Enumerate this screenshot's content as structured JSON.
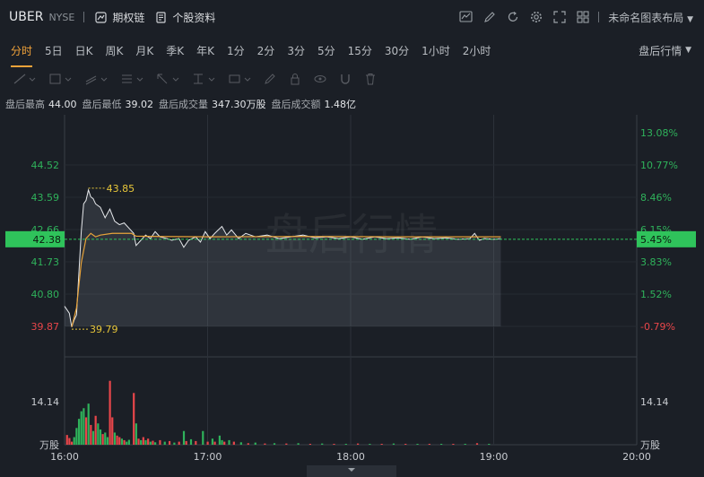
{
  "header": {
    "symbol": "UBER",
    "exchange": "NYSE",
    "options_chain": "期权链",
    "company_profile": "个股资料",
    "layout_name": "未命名图表布局"
  },
  "periods": [
    "分时",
    "5日",
    "日K",
    "周K",
    "月K",
    "季K",
    "年K",
    "1分",
    "2分",
    "3分",
    "5分",
    "15分",
    "30分",
    "1小时",
    "2小时"
  ],
  "active_period": "分时",
  "after_hours_menu": "盘后行情",
  "stats": {
    "high_label": "盘后最高",
    "high": "44.00",
    "low_label": "盘后最低",
    "low": "39.02",
    "vol_label": "盘后成交量",
    "vol": "347.30万股",
    "amt_label": "盘后成交额",
    "amt": "1.48亿"
  },
  "watermark": "盘后行情",
  "colors": {
    "up": "#2fb25b",
    "down": "#e8464a",
    "avg": "#e8a33a",
    "price": "#e6e8eb",
    "marker": "#e8c73a",
    "current_bg": "#2fc35b"
  },
  "chart_data": {
    "type": "line",
    "title": "",
    "price_axis_left": [
      "44.52",
      "43.59",
      "42.66",
      "41.73",
      "40.80",
      "39.87"
    ],
    "pct_axis_right": [
      "13.08%",
      "10.77%",
      "8.46%",
      "6.15%",
      "3.83%",
      "1.52%",
      "-0.79%"
    ],
    "ylim": [
      39.87,
      44.52
    ],
    "current_price": "42.38",
    "current_pct": "5.45%",
    "high_marker": "43.85",
    "low_marker": "39.79",
    "x_ticks": [
      "16:00",
      "17:00",
      "18:00",
      "19:00",
      "20:00"
    ],
    "volume_axis": [
      "14.14"
    ],
    "volume_unit_left": "万股",
    "volume_unit_right": "万股",
    "price_series": [
      {
        "t": 0,
        "v": 40.45
      },
      {
        "t": 2,
        "v": 40.25
      },
      {
        "t": 3,
        "v": 39.85
      },
      {
        "t": 4,
        "v": 40.05
      },
      {
        "t": 5,
        "v": 40.2
      },
      {
        "t": 6,
        "v": 41.4
      },
      {
        "t": 7,
        "v": 42.6
      },
      {
        "t": 8,
        "v": 43.4
      },
      {
        "t": 9,
        "v": 43.5
      },
      {
        "t": 10,
        "v": 43.8
      },
      {
        "t": 11,
        "v": 43.6
      },
      {
        "t": 12,
        "v": 43.55
      },
      {
        "t": 13,
        "v": 43.4
      },
      {
        "t": 15,
        "v": 43.3
      },
      {
        "t": 17,
        "v": 43.0
      },
      {
        "t": 19,
        "v": 43.25
      },
      {
        "t": 21,
        "v": 42.9
      },
      {
        "t": 23,
        "v": 42.8
      },
      {
        "t": 25,
        "v": 42.85
      },
      {
        "t": 27,
        "v": 42.7
      },
      {
        "t": 29,
        "v": 42.55
      },
      {
        "t": 30,
        "v": 42.2
      },
      {
        "t": 32,
        "v": 42.35
      },
      {
        "t": 34,
        "v": 42.5
      },
      {
        "t": 36,
        "v": 42.4
      },
      {
        "t": 38,
        "v": 42.6
      },
      {
        "t": 40,
        "v": 42.45
      },
      {
        "t": 43,
        "v": 42.4
      },
      {
        "t": 45,
        "v": 42.35
      },
      {
        "t": 48,
        "v": 42.4
      },
      {
        "t": 50,
        "v": 42.15
      },
      {
        "t": 52,
        "v": 42.35
      },
      {
        "t": 55,
        "v": 42.45
      },
      {
        "t": 57,
        "v": 42.3
      },
      {
        "t": 59,
        "v": 42.6
      },
      {
        "t": 61,
        "v": 42.4
      },
      {
        "t": 63,
        "v": 42.55
      },
      {
        "t": 66,
        "v": 42.75
      },
      {
        "t": 68,
        "v": 42.5
      },
      {
        "t": 70,
        "v": 42.65
      },
      {
        "t": 73,
        "v": 42.4
      },
      {
        "t": 76,
        "v": 42.55
      },
      {
        "t": 80,
        "v": 42.45
      },
      {
        "t": 85,
        "v": 42.5
      },
      {
        "t": 90,
        "v": 42.4
      },
      {
        "t": 95,
        "v": 42.45
      },
      {
        "t": 100,
        "v": 42.5
      },
      {
        "t": 105,
        "v": 42.42
      },
      {
        "t": 110,
        "v": 42.45
      },
      {
        "t": 115,
        "v": 42.4
      },
      {
        "t": 120,
        "v": 42.45
      },
      {
        "t": 125,
        "v": 42.38
      },
      {
        "t": 130,
        "v": 42.45
      },
      {
        "t": 135,
        "v": 42.4
      },
      {
        "t": 140,
        "v": 42.42
      },
      {
        "t": 145,
        "v": 42.38
      },
      {
        "t": 150,
        "v": 42.45
      },
      {
        "t": 155,
        "v": 42.4
      },
      {
        "t": 160,
        "v": 42.42
      },
      {
        "t": 165,
        "v": 42.38
      },
      {
        "t": 170,
        "v": 42.4
      },
      {
        "t": 172,
        "v": 42.55
      },
      {
        "t": 174,
        "v": 42.35
      },
      {
        "t": 176,
        "v": 42.4
      },
      {
        "t": 180,
        "v": 42.38
      },
      {
        "t": 183,
        "v": 42.4
      }
    ],
    "avg_series": [
      {
        "t": 3,
        "v": 39.85
      },
      {
        "t": 5,
        "v": 40.4
      },
      {
        "t": 7,
        "v": 41.7
      },
      {
        "t": 9,
        "v": 42.4
      },
      {
        "t": 11,
        "v": 42.55
      },
      {
        "t": 13,
        "v": 42.45
      },
      {
        "t": 15,
        "v": 42.5
      },
      {
        "t": 20,
        "v": 42.55
      },
      {
        "t": 28,
        "v": 42.55
      },
      {
        "t": 30,
        "v": 42.47
      },
      {
        "t": 40,
        "v": 42.46
      },
      {
        "t": 60,
        "v": 42.45
      },
      {
        "t": 100,
        "v": 42.46
      },
      {
        "t": 140,
        "v": 42.45
      },
      {
        "t": 183,
        "v": 42.45
      }
    ],
    "volume_max": 14.14,
    "volume_bars": [
      {
        "t": 1,
        "v": 3.2,
        "d": "down"
      },
      {
        "t": 2,
        "v": 2.2,
        "d": "down"
      },
      {
        "t": 3,
        "v": 1.0,
        "d": "down"
      },
      {
        "t": 4,
        "v": 2.5,
        "d": "up"
      },
      {
        "t": 5,
        "v": 5.5,
        "d": "up"
      },
      {
        "t": 6,
        "v": 8.5,
        "d": "up"
      },
      {
        "t": 7,
        "v": 11.0,
        "d": "up"
      },
      {
        "t": 8,
        "v": 12.0,
        "d": "up"
      },
      {
        "t": 9,
        "v": 9.0,
        "d": "down"
      },
      {
        "t": 10,
        "v": 13.5,
        "d": "up"
      },
      {
        "t": 11,
        "v": 6.5,
        "d": "down"
      },
      {
        "t": 12,
        "v": 4.5,
        "d": "up"
      },
      {
        "t": 13,
        "v": 9.5,
        "d": "down"
      },
      {
        "t": 14,
        "v": 7.0,
        "d": "up"
      },
      {
        "t": 15,
        "v": 5.0,
        "d": "up"
      },
      {
        "t": 16,
        "v": 3.5,
        "d": "down"
      },
      {
        "t": 17,
        "v": 4.0,
        "d": "up"
      },
      {
        "t": 18,
        "v": 2.5,
        "d": "up"
      },
      {
        "t": 19,
        "v": 21.0,
        "d": "down"
      },
      {
        "t": 20,
        "v": 9.0,
        "d": "down"
      },
      {
        "t": 21,
        "v": 4.0,
        "d": "up"
      },
      {
        "t": 22,
        "v": 3.0,
        "d": "down"
      },
      {
        "t": 23,
        "v": 2.5,
        "d": "down"
      },
      {
        "t": 24,
        "v": 2.0,
        "d": "up"
      },
      {
        "t": 25,
        "v": 1.5,
        "d": "down"
      },
      {
        "t": 26,
        "v": 1.0,
        "d": "up"
      },
      {
        "t": 27,
        "v": 1.6,
        "d": "up"
      },
      {
        "t": 29,
        "v": 17.0,
        "d": "down"
      },
      {
        "t": 30,
        "v": 7.0,
        "d": "up"
      },
      {
        "t": 31,
        "v": 2.0,
        "d": "down"
      },
      {
        "t": 32,
        "v": 1.5,
        "d": "up"
      },
      {
        "t": 33,
        "v": 2.5,
        "d": "down"
      },
      {
        "t": 34,
        "v": 1.5,
        "d": "up"
      },
      {
        "t": 35,
        "v": 2.0,
        "d": "down"
      },
      {
        "t": 36,
        "v": 1.0,
        "d": "up"
      },
      {
        "t": 37,
        "v": 1.3,
        "d": "down"
      },
      {
        "t": 38,
        "v": 0.8,
        "d": "up"
      },
      {
        "t": 40,
        "v": 1.5,
        "d": "down"
      },
      {
        "t": 42,
        "v": 1.0,
        "d": "up"
      },
      {
        "t": 44,
        "v": 1.2,
        "d": "down"
      },
      {
        "t": 46,
        "v": 0.7,
        "d": "up"
      },
      {
        "t": 48,
        "v": 1.0,
        "d": "down"
      },
      {
        "t": 50,
        "v": 4.5,
        "d": "up"
      },
      {
        "t": 51,
        "v": 1.2,
        "d": "down"
      },
      {
        "t": 53,
        "v": 1.8,
        "d": "up"
      },
      {
        "t": 55,
        "v": 1.2,
        "d": "down"
      },
      {
        "t": 58,
        "v": 4.5,
        "d": "up"
      },
      {
        "t": 60,
        "v": 1.0,
        "d": "down"
      },
      {
        "t": 62,
        "v": 2.0,
        "d": "up"
      },
      {
        "t": 63,
        "v": 1.0,
        "d": "down"
      },
      {
        "t": 65,
        "v": 3.0,
        "d": "up"
      },
      {
        "t": 66,
        "v": 1.5,
        "d": "up"
      },
      {
        "t": 67,
        "v": 1.0,
        "d": "down"
      },
      {
        "t": 69,
        "v": 1.5,
        "d": "up"
      },
      {
        "t": 71,
        "v": 1.0,
        "d": "down"
      },
      {
        "t": 74,
        "v": 0.8,
        "d": "up"
      },
      {
        "t": 77,
        "v": 0.5,
        "d": "down"
      },
      {
        "t": 80,
        "v": 0.7,
        "d": "up"
      },
      {
        "t": 84,
        "v": 0.4,
        "d": "down"
      },
      {
        "t": 88,
        "v": 0.5,
        "d": "up"
      },
      {
        "t": 93,
        "v": 0.4,
        "d": "down"
      },
      {
        "t": 98,
        "v": 0.5,
        "d": "up"
      },
      {
        "t": 103,
        "v": 0.3,
        "d": "down"
      },
      {
        "t": 108,
        "v": 0.4,
        "d": "up"
      },
      {
        "t": 113,
        "v": 0.3,
        "d": "down"
      },
      {
        "t": 118,
        "v": 0.3,
        "d": "up"
      },
      {
        "t": 123,
        "v": 0.4,
        "d": "down"
      },
      {
        "t": 128,
        "v": 0.3,
        "d": "up"
      },
      {
        "t": 133,
        "v": 0.3,
        "d": "down"
      },
      {
        "t": 138,
        "v": 0.4,
        "d": "up"
      },
      {
        "t": 143,
        "v": 0.3,
        "d": "down"
      },
      {
        "t": 148,
        "v": 0.3,
        "d": "up"
      },
      {
        "t": 153,
        "v": 0.3,
        "d": "down"
      },
      {
        "t": 158,
        "v": 0.3,
        "d": "up"
      },
      {
        "t": 163,
        "v": 0.3,
        "d": "down"
      },
      {
        "t": 168,
        "v": 0.3,
        "d": "up"
      },
      {
        "t": 173,
        "v": 0.5,
        "d": "down"
      },
      {
        "t": 178,
        "v": 0.3,
        "d": "up"
      }
    ]
  }
}
